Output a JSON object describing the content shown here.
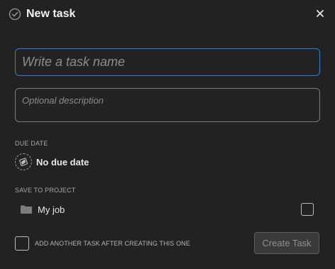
{
  "dialog": {
    "title": "New task",
    "close_icon": "close-icon",
    "title_icon": "check-circle-icon"
  },
  "task_name": {
    "placeholder": "Write a task name",
    "value": ""
  },
  "description": {
    "placeholder": "Optional description",
    "value": ""
  },
  "due_date": {
    "section_label": "DUE DATE",
    "value": "No due date",
    "icon": "calendar-flag-icon"
  },
  "project": {
    "section_label": "SAVE TO PROJECT",
    "name": "My job",
    "icon": "folder-icon",
    "checked": false
  },
  "footer": {
    "another_task_label": "ADD ANOTHER TASK AFTER CREATING THIS ONE",
    "another_task_checked": false,
    "create_label": "Create Task"
  },
  "colors": {
    "background": "#222222",
    "focus_border": "#2f7ed8",
    "input_border": "#7a7a7a",
    "button_bg": "#3a3a3a",
    "button_text": "#8f8f8f"
  }
}
